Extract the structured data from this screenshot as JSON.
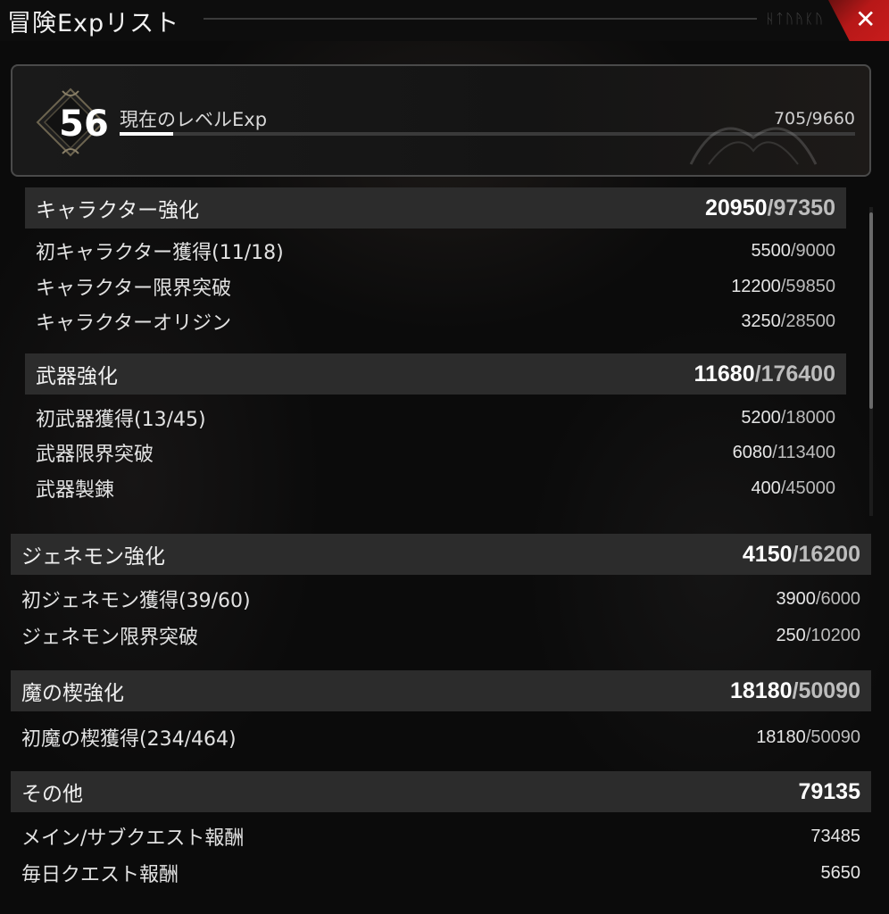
{
  "window": {
    "title": "冒険Expリスト",
    "header_rune": "ᚺᛏᚢᚤᛕᚢ"
  },
  "level": {
    "number": "56",
    "label": "現在のレベルExp",
    "current": "705",
    "max": "9660",
    "progress": 0.073
  },
  "sections": {
    "character": {
      "label": "キャラクター強化",
      "value": "20950",
      "total": "97350",
      "items": [
        {
          "label": "初キャラクター獲得(11/18)",
          "value": "5500",
          "total": "9000"
        },
        {
          "label": "キャラクター限界突破",
          "value": "12200",
          "total": "59850"
        },
        {
          "label": "キャラクターオリジン",
          "value": "3250",
          "total": "28500"
        }
      ]
    },
    "weapon": {
      "label": "武器強化",
      "value": "11680",
      "total": "176400",
      "items": [
        {
          "label": "初武器獲得(13/45)",
          "value": "5200",
          "total": "18000"
        },
        {
          "label": "武器限界突破",
          "value": "6080",
          "total": "113400"
        },
        {
          "label": "武器製錬",
          "value": "400",
          "total": "45000"
        }
      ]
    },
    "genemon": {
      "label": "ジェネモン強化",
      "value": "4150",
      "total": "16200",
      "items": [
        {
          "label": "初ジェネモン獲得(39/60)",
          "value": "3900",
          "total": "6000"
        },
        {
          "label": "ジェネモン限界突破",
          "value": "250",
          "total": "10200"
        }
      ]
    },
    "demon_wedge": {
      "label": "魔の楔強化",
      "value": "18180",
      "total": "50090",
      "items": [
        {
          "label": "初魔の楔獲得(234/464)",
          "value": "18180",
          "total": "50090"
        }
      ]
    },
    "other": {
      "label": "その他",
      "value": "79135",
      "items": [
        {
          "label": "メイン/サブクエスト報酬",
          "value": "73485"
        },
        {
          "label": "毎日クエスト報酬",
          "value": "5650"
        }
      ]
    }
  },
  "separator": "/",
  "colors": {
    "close_button": "#c81c1c",
    "section_header_bg": "#2c2c2c",
    "progress_fill": "#ffffff"
  }
}
